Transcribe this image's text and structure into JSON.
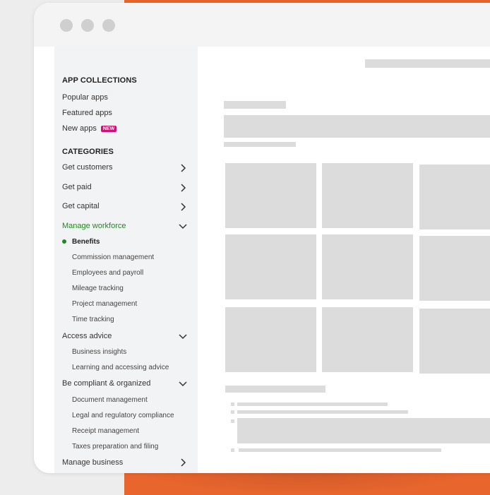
{
  "sidebar": {
    "app_collections": {
      "heading": "APP COLLECTIONS",
      "items": [
        {
          "label": "Popular apps"
        },
        {
          "label": "Featured apps"
        },
        {
          "label": "New apps",
          "badge": "NEW"
        }
      ]
    },
    "categories": {
      "heading": "CATEGORIES",
      "items": [
        {
          "label": "Get customers"
        },
        {
          "label": "Get paid"
        },
        {
          "label": "Get capital"
        },
        {
          "label": "Manage workforce"
        },
        {
          "label": "Access advice"
        },
        {
          "label": "Be compliant & organized"
        },
        {
          "label": "Manage business"
        }
      ],
      "manage_workforce_sub": [
        {
          "label": "Benefits"
        },
        {
          "label": "Commission management"
        },
        {
          "label": "Employees and payroll"
        },
        {
          "label": "Mileage tracking"
        },
        {
          "label": "Project management"
        },
        {
          "label": "Time tracking"
        }
      ],
      "access_advice_sub": [
        {
          "label": "Business insights"
        },
        {
          "label": "Learning and accessing advice"
        }
      ],
      "compliant_sub": [
        {
          "label": "Document management"
        },
        {
          "label": "Legal and regulatory compliance"
        },
        {
          "label": "Receipt management"
        },
        {
          "label": "Taxes preparation and filing"
        }
      ]
    }
  },
  "colors": {
    "accent_orange": "#e8652e",
    "active_green": "#228822",
    "badge_magenta": "#cc1177",
    "placeholder_gray": "#dcdcdc"
  }
}
